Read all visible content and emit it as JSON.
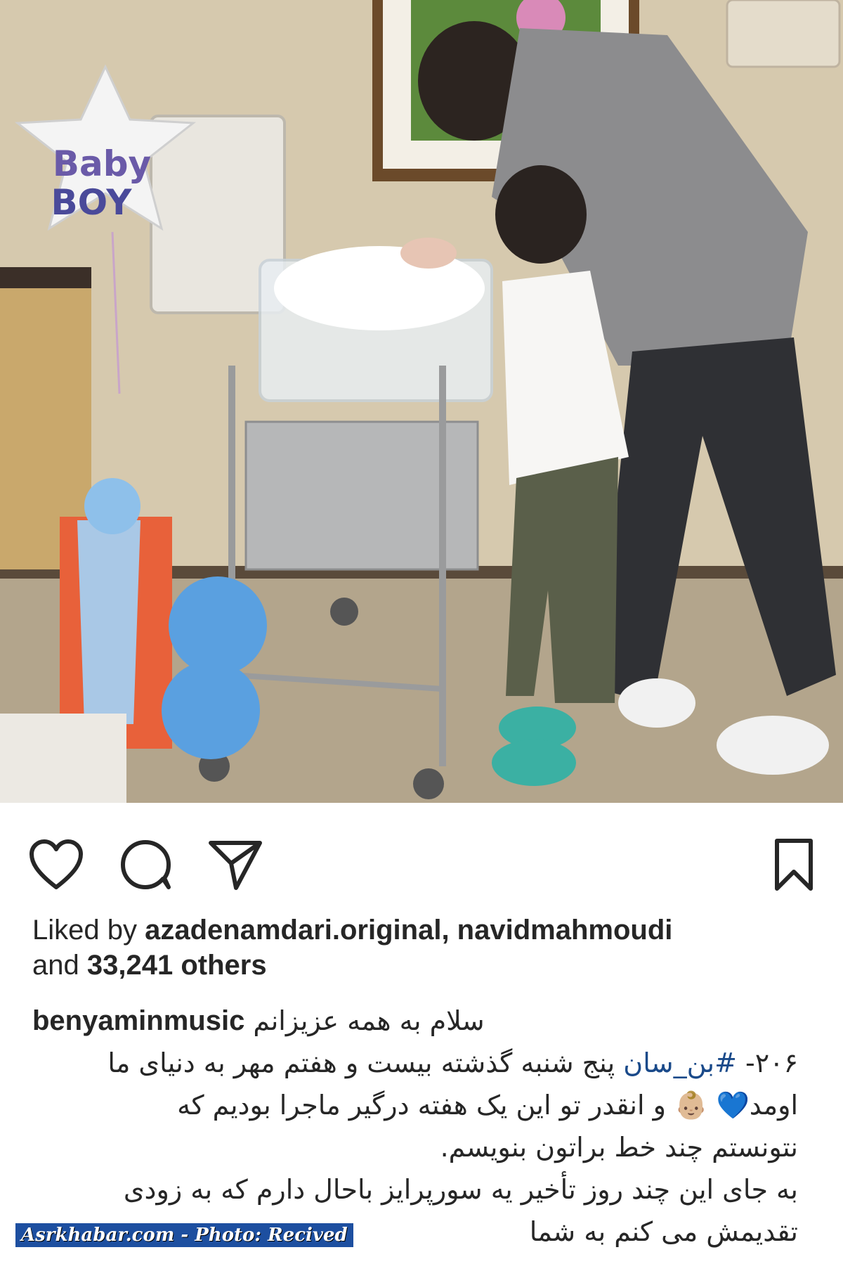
{
  "photo": {
    "balloon_line1": "Baby",
    "balloon_line2": "BOY"
  },
  "actions": {
    "like_icon": "heart-icon",
    "comment_icon": "comment-icon",
    "share_icon": "paper-plane-icon",
    "save_icon": "bookmark-icon"
  },
  "likes": {
    "prefix": "Liked by",
    "users": "azadenamdari.original, navidmahmoudi",
    "and": "and",
    "count": "33,241 others"
  },
  "caption": {
    "username": "benyaminmusic",
    "greeting": "سلام به همه عزیزانم",
    "line1_pre": "۲۰۶-",
    "hashtag": "#بن_سان",
    "line1_post": "پنج شنبه گذشته بیست و هفتم مهر به دنیای ما",
    "line2": "اومد💙 👶🏼 و انقدر تو این یک هفته درگیر ماجرا بودیم که",
    "line3": "نتونستم چند خط براتون بنویسم.",
    "line4": "به جای این چند روز تأخیر یه سورپرایز باحال دارم که به زودی",
    "line5": "تقدیمش می کنم به شما"
  },
  "watermark": "Asrkhabar.com - Photo: Recived"
}
